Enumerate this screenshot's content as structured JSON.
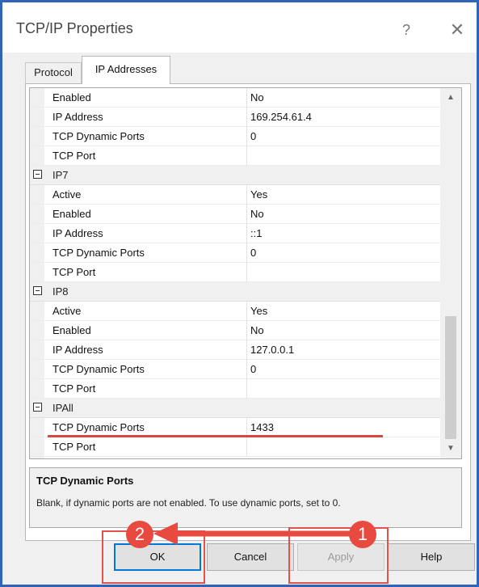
{
  "window": {
    "title": "TCP/IP Properties",
    "help_glyph": "?",
    "close_glyph": "✕"
  },
  "tabs": [
    {
      "label": "Protocol"
    },
    {
      "label": "IP Addresses"
    }
  ],
  "grid": {
    "rows": [
      {
        "type": "prop",
        "name": "Enabled",
        "value": "No"
      },
      {
        "type": "prop",
        "name": "IP Address",
        "value": "169.254.61.4"
      },
      {
        "type": "prop",
        "name": "TCP Dynamic Ports",
        "value": "0"
      },
      {
        "type": "prop",
        "name": "TCP Port",
        "value": ""
      },
      {
        "type": "cat",
        "name": "IP7"
      },
      {
        "type": "prop",
        "name": "Active",
        "value": "Yes"
      },
      {
        "type": "prop",
        "name": "Enabled",
        "value": "No"
      },
      {
        "type": "prop",
        "name": "IP Address",
        "value": "::1"
      },
      {
        "type": "prop",
        "name": "TCP Dynamic Ports",
        "value": "0"
      },
      {
        "type": "prop",
        "name": "TCP Port",
        "value": ""
      },
      {
        "type": "cat",
        "name": "IP8"
      },
      {
        "type": "prop",
        "name": "Active",
        "value": "Yes"
      },
      {
        "type": "prop",
        "name": "Enabled",
        "value": "No"
      },
      {
        "type": "prop",
        "name": "IP Address",
        "value": "127.0.0.1"
      },
      {
        "type": "prop",
        "name": "TCP Dynamic Ports",
        "value": "0"
      },
      {
        "type": "prop",
        "name": "TCP Port",
        "value": ""
      },
      {
        "type": "cat",
        "name": "IPAll"
      },
      {
        "type": "prop",
        "name": "TCP Dynamic Ports",
        "value": "1433"
      },
      {
        "type": "prop",
        "name": "TCP Port",
        "value": ""
      }
    ]
  },
  "description": {
    "title": "TCP Dynamic Ports",
    "text": "Blank, if dynamic ports are not enabled. To use dynamic ports, set to 0."
  },
  "buttons": {
    "ok": "OK",
    "cancel": "Cancel",
    "apply": "Apply",
    "help": "Help"
  },
  "annotations": {
    "step1": "1",
    "step2": "2",
    "color": "#e84a3f"
  }
}
